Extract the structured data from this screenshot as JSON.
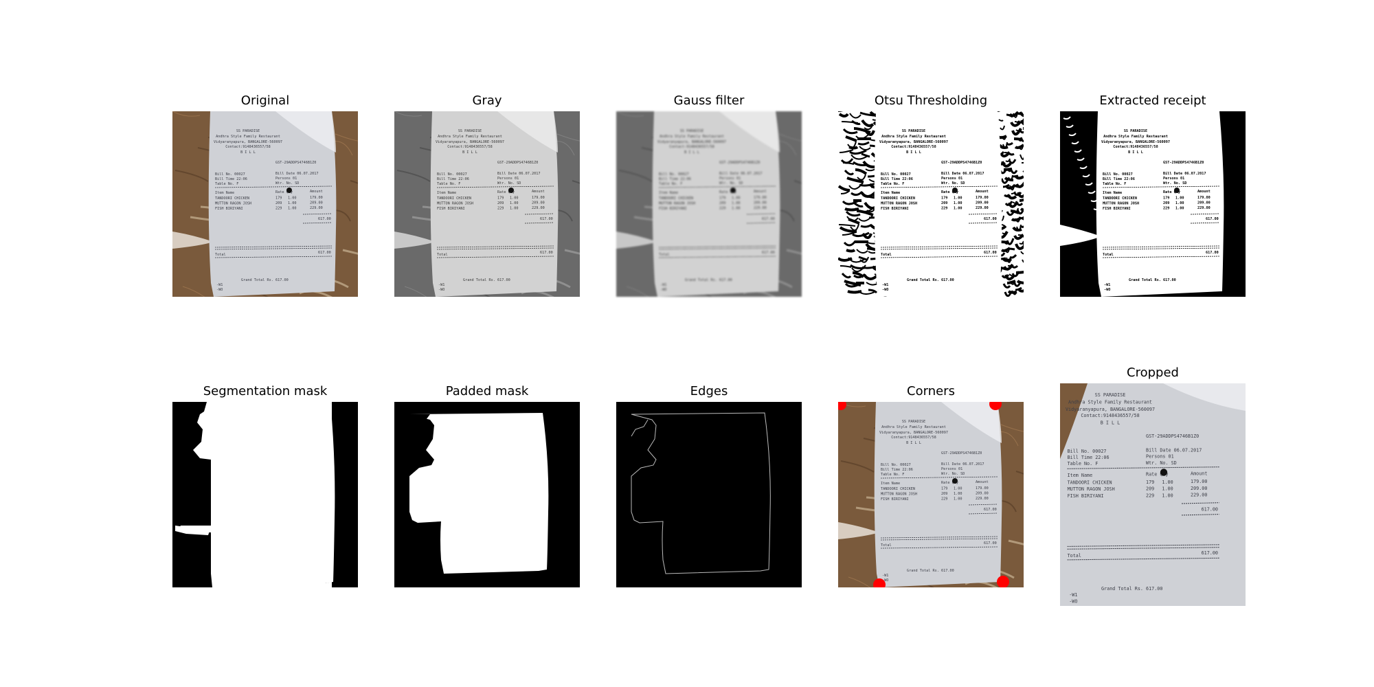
{
  "panels": [
    {
      "title": "Original"
    },
    {
      "title": "Gray"
    },
    {
      "title": "Gauss filter"
    },
    {
      "title": "Otsu Thresholding"
    },
    {
      "title": "Extracted receipt"
    },
    {
      "title": "Segmentation mask"
    },
    {
      "title": "Padded mask"
    },
    {
      "title": "Edges"
    },
    {
      "title": "Corners"
    },
    {
      "title": "Cropped"
    }
  ],
  "receipt": {
    "header1": "SS PARADISE",
    "header2": "Andhra Style Family Restaurant",
    "header3": "Vidyaranyapura, BANGALORE-560097",
    "header4": "Contact:9148436557/58",
    "bill_label": "B I L L",
    "gst": "GST-29ADDPS4746B1Z0",
    "bill_no": "Bill No.    00027",
    "bill_date": "Bill Date 06.07.2017",
    "bill_time": "Bill Time  22:06",
    "persons": "Persons    01",
    "table_no": "Table No.  F",
    "wtr": "Wtr. No.   SD",
    "col_item": "Item Name",
    "col_rate": "Rate Qty",
    "col_amount": "Amount",
    "items": [
      {
        "name": "TANDOORI CHICKEN",
        "rate": "179",
        "qty": "1.00",
        "amount": "179.00"
      },
      {
        "name": "MUTTON RAGON JOSH",
        "rate": "209",
        "qty": "1.00",
        "amount": "209.00"
      },
      {
        "name": "FISH BIRIYANI",
        "rate": "229",
        "qty": "1.00",
        "amount": "229.00"
      }
    ],
    "subtotal": "617.00",
    "total_label": "Total",
    "total_value": "617.00",
    "grand_total": "Grand Total Rs.  617.00",
    "footer1": "-W1",
    "footer2": "-WO"
  }
}
